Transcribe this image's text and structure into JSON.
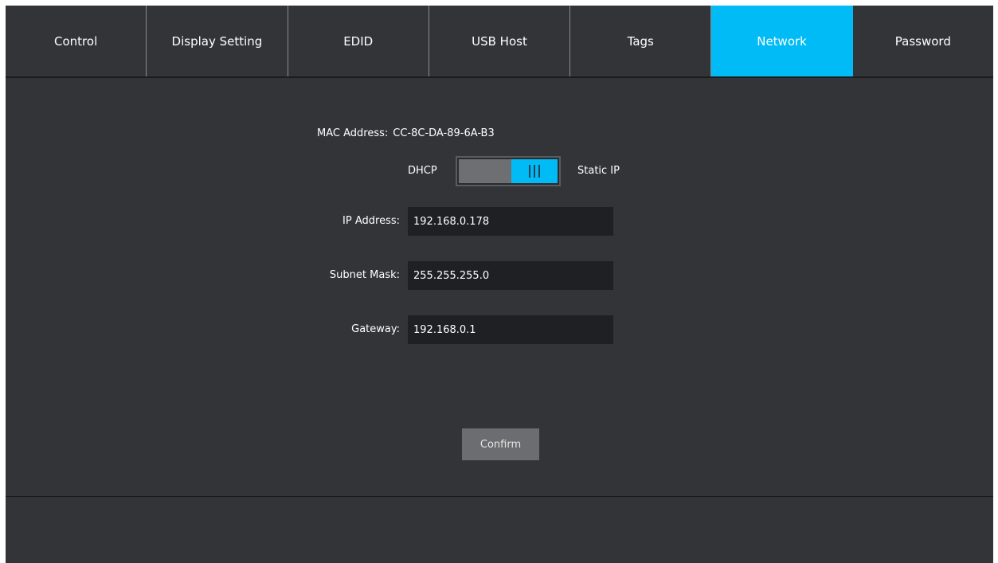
{
  "tabs": [
    {
      "label": "Control",
      "active": false
    },
    {
      "label": "Display Setting",
      "active": false
    },
    {
      "label": "EDID",
      "active": false
    },
    {
      "label": "USB Host",
      "active": false
    },
    {
      "label": "Tags",
      "active": false
    },
    {
      "label": "Network",
      "active": true
    },
    {
      "label": "Password",
      "active": false
    }
  ],
  "network": {
    "mac_label": "MAC Address:",
    "mac_value": "CC-8C-DA-89-6A-B3",
    "mode_left_label": "DHCP",
    "mode_right_label": "Static IP",
    "mode_selected": "Static IP",
    "ip_label": "IP Address:",
    "ip_value": "192.168.0.178",
    "subnet_label": "Subnet Mask:",
    "subnet_value": "255.255.255.0",
    "gateway_label": "Gateway:",
    "gateway_value": "192.168.0.1",
    "confirm_label": "Confirm"
  },
  "colors": {
    "accent": "#00bbf5",
    "background": "#333438",
    "input_background": "#1f2023",
    "button_background": "#6c6d70"
  },
  "icons": {
    "toggle_grip": "grip-lines-icon"
  }
}
